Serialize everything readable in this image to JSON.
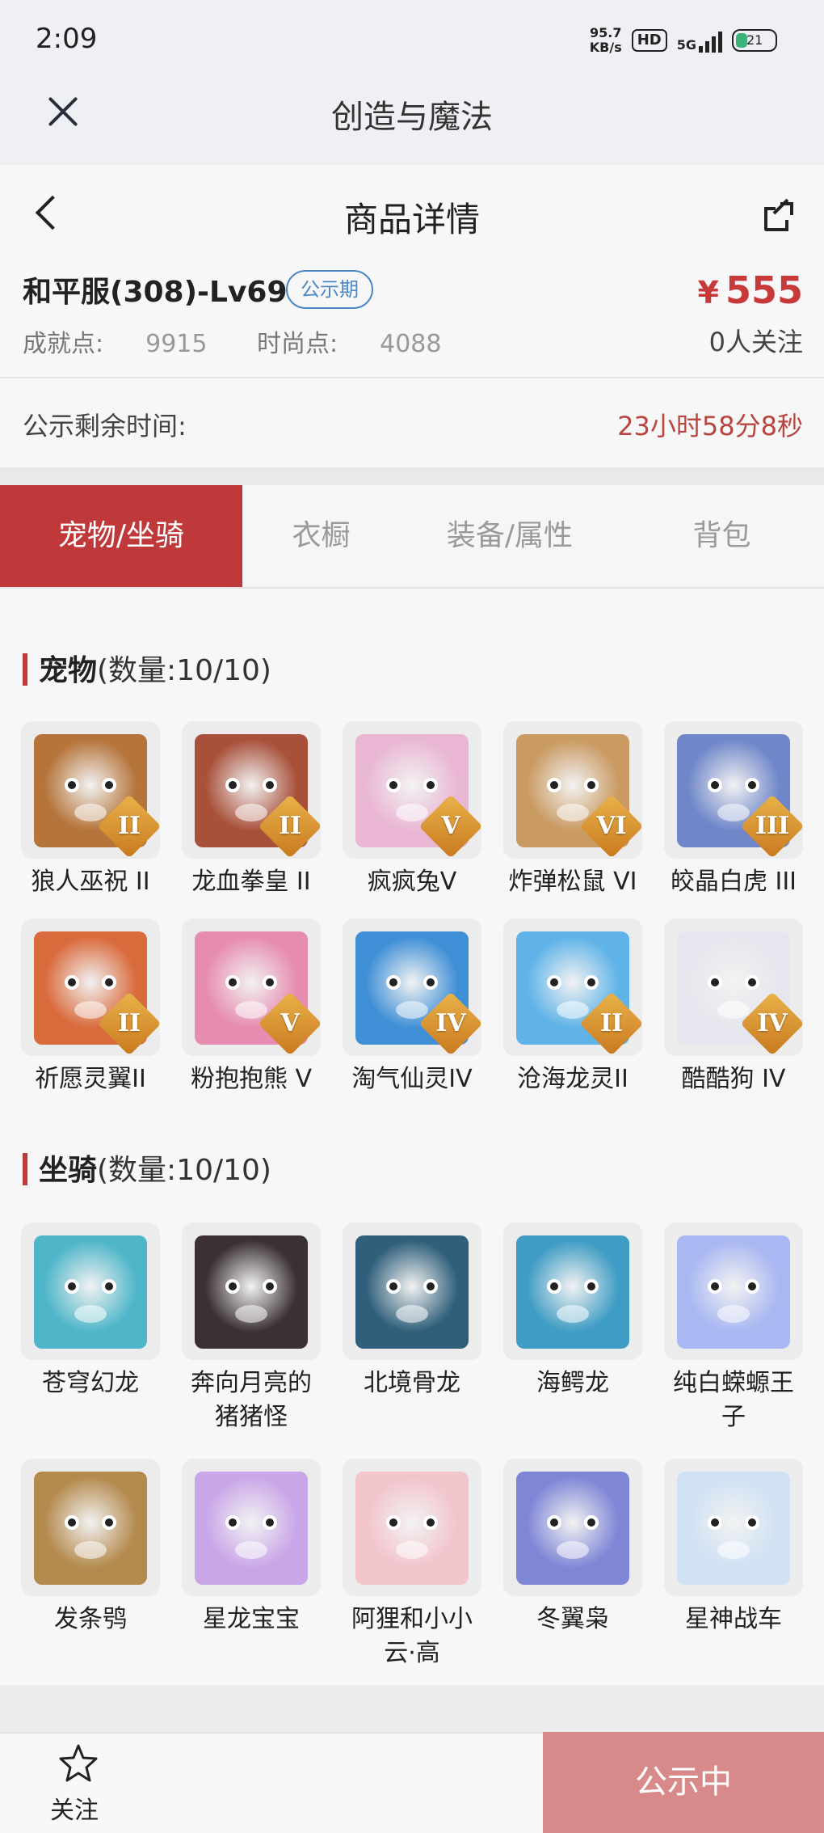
{
  "status_bar": {
    "time": "2:09",
    "net_speed_value": "95.7",
    "net_speed_unit": "KB/s",
    "hd": "HD",
    "network": "5G",
    "battery": "21"
  },
  "app": {
    "title": "创造与魔法"
  },
  "header": {
    "title": "商品详情"
  },
  "product": {
    "server": "和平服(308)-Lv69",
    "tag": "公示期",
    "price_symbol": "¥",
    "price": "555",
    "achievement_label": "成就点:",
    "achievement": "9915",
    "fashion_label": "时尚点:",
    "fashion": "4088",
    "followers": "0人关注",
    "remain_label": "公示剩余时间:",
    "remain_value": "23小时58分8秒"
  },
  "tabs": [
    "宠物/坐骑",
    "衣橱",
    "装备/属性",
    "背包"
  ],
  "pets_section": {
    "label": "宠物",
    "count": "(数量:10/10)"
  },
  "pets": [
    {
      "name": "狼人巫祝 II",
      "badge": "II",
      "color": "#b5743a"
    },
    {
      "name": "龙血拳皇 II",
      "badge": "II",
      "color": "#a8503a"
    },
    {
      "name": "疯疯兔V",
      "badge": "V",
      "color": "#e9b7d4"
    },
    {
      "name": "炸弹松鼠 VI",
      "badge": "VI",
      "color": "#c99a62"
    },
    {
      "name": "皎晶白虎 III",
      "badge": "III",
      "color": "#6f86c9"
    },
    {
      "name": "祈愿灵翼II",
      "badge": "II",
      "color": "#d96a3c"
    },
    {
      "name": "粉抱抱熊 V",
      "badge": "V",
      "color": "#e68cb0"
    },
    {
      "name": "淘气仙灵IV",
      "badge": "IV",
      "color": "#3f8fd6"
    },
    {
      "name": "沧海龙灵II",
      "badge": "II",
      "color": "#5fb3e8"
    },
    {
      "name": "酷酷狗 IV",
      "badge": "IV",
      "color": "#e6e6ee"
    }
  ],
  "mounts_section": {
    "label": "坐骑",
    "count": "(数量:10/10)"
  },
  "mounts": [
    {
      "name": "苍穹幻龙",
      "color": "#4fb6c9"
    },
    {
      "name": "奔向月亮的猪猪怪",
      "color": "#3a3036"
    },
    {
      "name": "北境骨龙",
      "color": "#2f5f7a"
    },
    {
      "name": "海鳄龙",
      "color": "#3f9cc4"
    },
    {
      "name": "纯白蝾螈王子",
      "color": "#a9b7f2"
    },
    {
      "name": "发条鸮",
      "color": "#b48a4e"
    },
    {
      "name": "星龙宝宝",
      "color": "#c9a6e8"
    },
    {
      "name": "阿狸和小小云·高",
      "color": "#f2c4cc"
    },
    {
      "name": "冬翼枭",
      "color": "#7f86d6"
    },
    {
      "name": "星神战车",
      "color": "#cfe1f3"
    }
  ],
  "footer": {
    "follow_label": "关注",
    "cta": "公示中"
  }
}
